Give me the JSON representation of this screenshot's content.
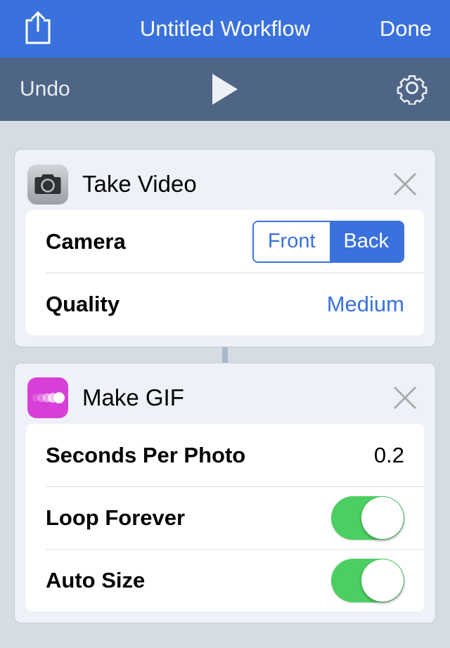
{
  "navbar": {
    "share_icon": "share-upload-icon",
    "title": "Untitled Workflow",
    "done_label": "Done",
    "background_color": "#3a72dd"
  },
  "toolbar": {
    "undo_label": "Undo",
    "play_icon": "play-icon",
    "settings_icon": "gear-icon",
    "background_color": "#4e6586"
  },
  "workflow": {
    "actions": [
      {
        "icon": "camera-icon",
        "icon_color": "#b9bdc2",
        "title": "Take Video",
        "close_icon": "close-icon",
        "rows": [
          {
            "label": "Camera",
            "type": "segmented",
            "options": [
              "Front",
              "Back"
            ],
            "selected": "Back"
          },
          {
            "label": "Quality",
            "type": "value-link",
            "value": "Medium"
          }
        ]
      },
      {
        "icon": "gif-dots-icon",
        "icon_color": "#d83fd8",
        "title": "Make GIF",
        "close_icon": "close-icon",
        "rows": [
          {
            "label": "Seconds Per Photo",
            "type": "value",
            "value": "0.2"
          },
          {
            "label": "Loop Forever",
            "type": "toggle",
            "on": true
          },
          {
            "label": "Auto Size",
            "type": "toggle",
            "on": true
          }
        ]
      }
    ]
  },
  "colors": {
    "accent_blue": "#3a72dd",
    "toolbar_slate": "#4e6586",
    "toggle_green": "#4ccf62",
    "page_background": "#d6dce4",
    "card_background": "#eef1f7"
  }
}
